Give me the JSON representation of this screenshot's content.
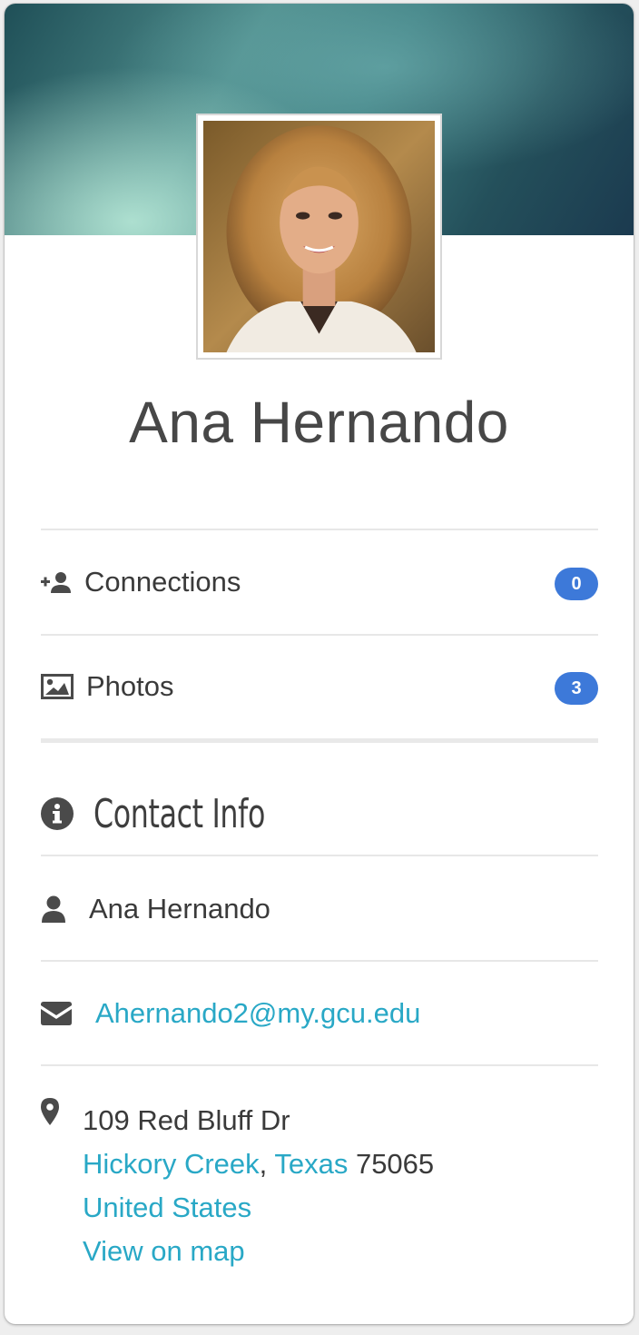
{
  "profile": {
    "name": "Ana Hernando",
    "cover_colors": [
      "#1f4f57",
      "#4f8e8d",
      "#bfeedd",
      "#1b3a4f"
    ]
  },
  "stats": {
    "connections": {
      "label": "Connections",
      "count": "0",
      "icon": "add-user-icon"
    },
    "photos": {
      "label": "Photos",
      "count": "3",
      "icon": "image-icon"
    }
  },
  "contact": {
    "title": "Contact Info",
    "name": "Ana Hernando",
    "email": "Ahernando2@my.gcu.edu",
    "address": {
      "street": "109 Red Bluff Dr",
      "city": "Hickory Creek",
      "separator": ",",
      "state": "Texas",
      "zip": "75065",
      "country": "United States",
      "map_link": "View on map"
    }
  },
  "colors": {
    "badge": "#3d79d9",
    "link": "#29a8c6",
    "text": "#3a3a3a"
  }
}
